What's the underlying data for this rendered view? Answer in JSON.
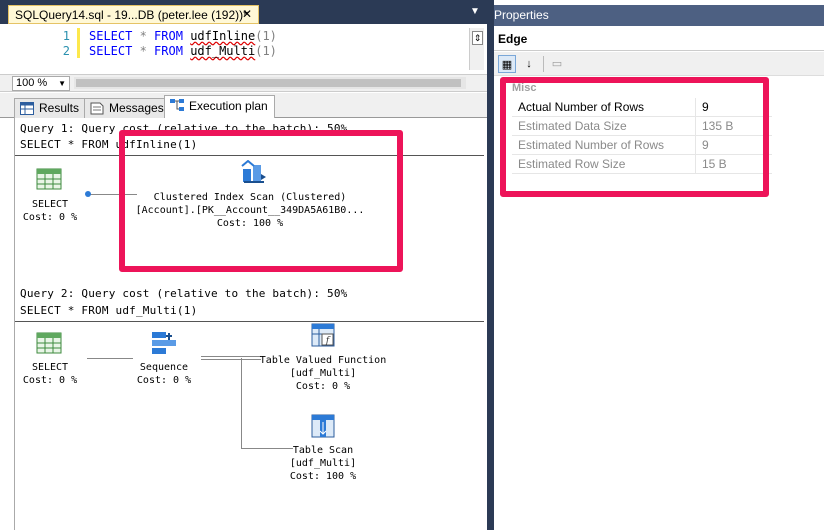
{
  "editor": {
    "tab_title": "SQLQuery14.sql - 19...DB (peter.lee (192))*",
    "tab_close": "✕",
    "line_numbers": [
      "1",
      "2"
    ],
    "lines": [
      {
        "kw1": "SELECT",
        "star": " * ",
        "kw2": "FROM",
        "fn": "udfInline",
        "arg": "(1)"
      },
      {
        "kw1": "SELECT",
        "star": " * ",
        "kw2": "FROM",
        "fn": "udf_Multi",
        "arg": "(1)"
      }
    ],
    "zoom": "100 %"
  },
  "result_tabs": [
    {
      "label": "Results",
      "icon": "grid-icon"
    },
    {
      "label": "Messages",
      "icon": "message-icon"
    },
    {
      "label": "Execution plan",
      "icon": "execution-plan-icon"
    }
  ],
  "plan": {
    "query1": {
      "header": "Query 1: Query cost (relative to the batch): 50%",
      "sql": "SELECT * FROM udfInline(1)",
      "select_node": {
        "name": "SELECT",
        "cost": "Cost: 0 %"
      },
      "scan_node": {
        "name": "Clustered Index Scan (Clustered)",
        "object": "[Account].[PK__Account__349DA5A61B0...",
        "cost": "Cost: 100 %"
      }
    },
    "query2": {
      "header": "Query 2: Query cost (relative to the batch): 50%",
      "sql": "SELECT * FROM udf_Multi(1)",
      "select_node": {
        "name": "SELECT",
        "cost": "Cost: 0 %"
      },
      "sequence_node": {
        "name": "Sequence",
        "cost": "Cost: 0 %"
      },
      "tvf_node": {
        "name": "Table Valued Function",
        "object": "[udf_Multi]",
        "cost": "Cost: 0 %"
      },
      "tablescan_node": {
        "name": "Table Scan",
        "object": "[udf_Multi]",
        "cost": "Cost: 100 %"
      }
    }
  },
  "properties": {
    "panel_title": "Properties",
    "object": "Edge",
    "category": "Misc",
    "rows": [
      {
        "key": "Actual Number of Rows",
        "value": "9"
      },
      {
        "key": "Estimated Data Size",
        "value": "135 B"
      },
      {
        "key": "Estimated Number of Rows",
        "value": "9"
      },
      {
        "key": "Estimated Row Size",
        "value": "15 B"
      }
    ]
  },
  "colors": {
    "highlight": "#ed1459",
    "keyword": "#0000ff",
    "line_number": "#2b91af",
    "panel_header": "#4d6082"
  }
}
